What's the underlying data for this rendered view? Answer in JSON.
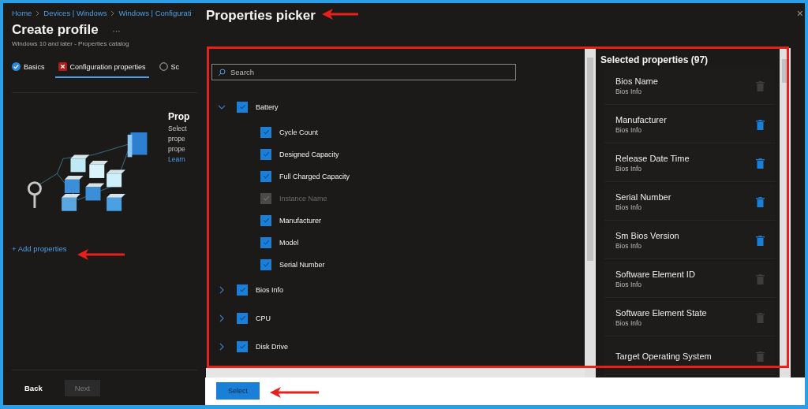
{
  "page": {
    "breadcrumb": [
      "Home",
      "Devices | Windows",
      "Windows | Configurati"
    ],
    "title": "Create profile",
    "more": "···",
    "subtitle": "Windows 10 and later - Properties catalog",
    "tabs": [
      {
        "label": "Basics",
        "kind": "done",
        "selected": false
      },
      {
        "label": "Configuration properties",
        "kind": "error",
        "selected": true
      },
      {
        "label": "Sc",
        "kind": "pending",
        "selected": false
      }
    ],
    "intro": {
      "heading": "Prop",
      "lines": [
        "Select",
        "prope",
        "prope"
      ],
      "link": "Learn"
    },
    "add_link": "+ Add properties",
    "buttons": [
      {
        "label": "Back",
        "disabled": false
      },
      {
        "label": "Next",
        "disabled": true
      }
    ]
  },
  "picker": {
    "title": "Properties picker",
    "close": "×",
    "search": {
      "placeholder": "Search"
    },
    "tree": [
      {
        "label": "Battery",
        "expanded": true,
        "checked": true,
        "children": [
          {
            "label": "Cycle Count",
            "checked": true,
            "disabled": false
          },
          {
            "label": "Designed Capacity",
            "checked": true,
            "disabled": false
          },
          {
            "label": "Full Charged Capacity",
            "checked": true,
            "disabled": false
          },
          {
            "label": "Instance Name",
            "checked": true,
            "disabled": true
          },
          {
            "label": "Manufacturer",
            "checked": true,
            "disabled": false
          },
          {
            "label": "Model",
            "checked": true,
            "disabled": false
          },
          {
            "label": "Serial Number",
            "checked": true,
            "disabled": false
          }
        ]
      },
      {
        "label": "Bios Info",
        "expanded": false,
        "checked": true
      },
      {
        "label": "CPU",
        "expanded": false,
        "checked": true
      },
      {
        "label": "Disk Drive",
        "expanded": false,
        "checked": true
      }
    ],
    "selected": {
      "title": "Selected properties (97)",
      "items": [
        {
          "name": "Bios Name",
          "group": "Bios Info",
          "disabled": true
        },
        {
          "name": "Manufacturer",
          "group": "Bios Info",
          "disabled": false
        },
        {
          "name": "Release Date Time",
          "group": "Bios Info",
          "disabled": false
        },
        {
          "name": "Serial Number",
          "group": "Bios Info",
          "disabled": false
        },
        {
          "name": "Sm Bios Version",
          "group": "Bios Info",
          "disabled": false
        },
        {
          "name": "Software Element ID",
          "group": "Bios Info",
          "disabled": true
        },
        {
          "name": "Software Element State",
          "group": "Bios Info",
          "disabled": true
        },
        {
          "name": "Target Operating System",
          "disabled": true
        }
      ]
    },
    "select_button": "Select"
  }
}
